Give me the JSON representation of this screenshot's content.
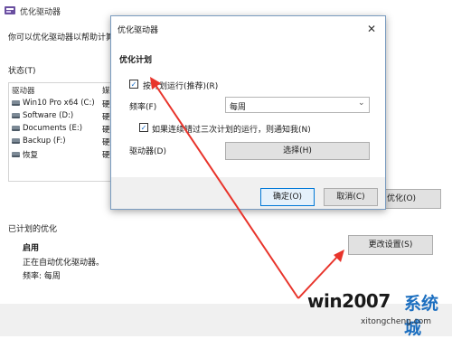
{
  "background_window": {
    "title": "优化驱动器",
    "description": "你可以优化驱动器以帮助计算机",
    "status_label": "状态(T)",
    "table": {
      "col_drive": "驱动器",
      "col_media": "媒",
      "rows": [
        {
          "name": "Win10 Pro x64 (C:)",
          "media": "硬盘"
        },
        {
          "name": "Software (D:)",
          "media": "硬盘"
        },
        {
          "name": "Documents (E:)",
          "media": "硬盘"
        },
        {
          "name": "Backup (F:)",
          "media": "硬盘"
        },
        {
          "name": "恢复",
          "media": "硬盘"
        }
      ]
    },
    "optimize_button": "优化(O)",
    "scheduled_label": "已计划的优化",
    "enabled_label": "启用",
    "running_text": "正在自动优化驱动器。",
    "frequency_text": "频率: 每周",
    "change_settings_button": "更改设置(S)"
  },
  "dialog": {
    "title": "优化驱动器",
    "close_glyph": "✕",
    "section_title": "优化计划",
    "run_on_schedule": {
      "label": "按计划运行(推荐)(R)",
      "checked": true
    },
    "frequency": {
      "label": "频率(F)",
      "value": "每周",
      "arrow": "⌄"
    },
    "notify": {
      "label": "如果连续错过三次计划的运行，则通知我(N)",
      "checked": true
    },
    "drives_label": "驱动器(D)",
    "select_button": "选择(H)",
    "ok_button": "确定(O)",
    "cancel_button": "取消(C)"
  },
  "watermark": {
    "brand": "win2007",
    "brand_cn": "系统城",
    "url": "xitongcheng.com"
  },
  "colors": {
    "arrow": "#e8342b",
    "accent": "#0078d7",
    "watermark_cn": "#1c6fc0"
  }
}
